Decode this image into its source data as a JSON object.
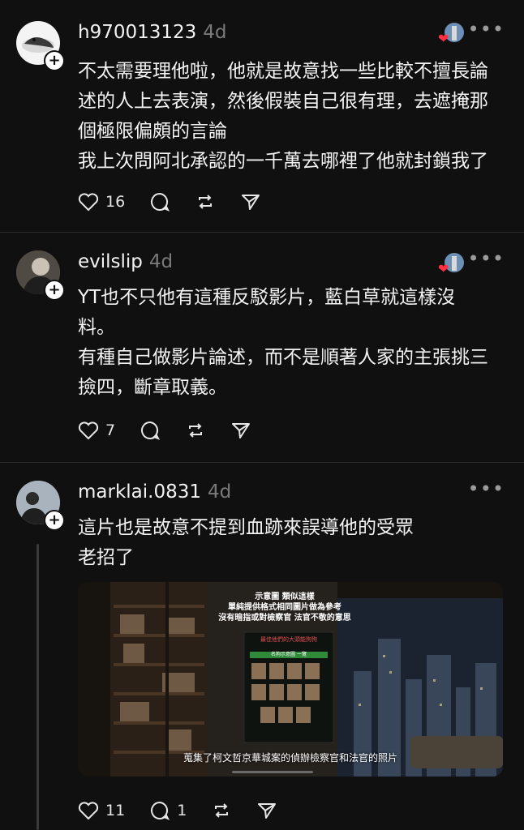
{
  "posts": [
    {
      "username": "h970013123",
      "time": "4d",
      "lines": [
        "不太需要理他啦，他就是故意找一些比較不擅長論",
        "述的人上去表演，然後假裝自己很有理，去遮掩那",
        "個極限偏頗的言論",
        "我上次問阿北承認的一千萬去哪裡了他就封鎖我了"
      ],
      "likes": "16",
      "replies": "",
      "more_icon": "more-icon"
    },
    {
      "username": "evilslip",
      "time": "4d",
      "lines": [
        "YT也不只他有這種反駁影片，藍白草就這樣沒",
        "料。",
        "有種自己做影片論述，而不是順著人家的主張挑三",
        "撿四，斷章取義。"
      ],
      "likes": "7",
      "replies": ""
    },
    {
      "username": "marklai.0831",
      "time": "4d",
      "lines": [
        "這片也是故意不提到血跡來誤導他的受眾",
        "老招了"
      ],
      "likes": "11",
      "replies": "1",
      "media": {
        "caption_top": [
          "示意圖 類似這樣",
          "單純提供格式相同圖片做為參考",
          "沒有暗指或對檢察官 法官不敬的意思"
        ],
        "poster_title": "最佳他們的大頭能狗狗",
        "poster_subtitle": "名狗示意圖 一覽",
        "subtitle": "蒐集了柯文哲京華城案的偵辦檢察官和法官的照片"
      }
    }
  ],
  "colors": {
    "background": "#101010",
    "heart": "#ff3040",
    "muted": "#7a7a7a"
  }
}
